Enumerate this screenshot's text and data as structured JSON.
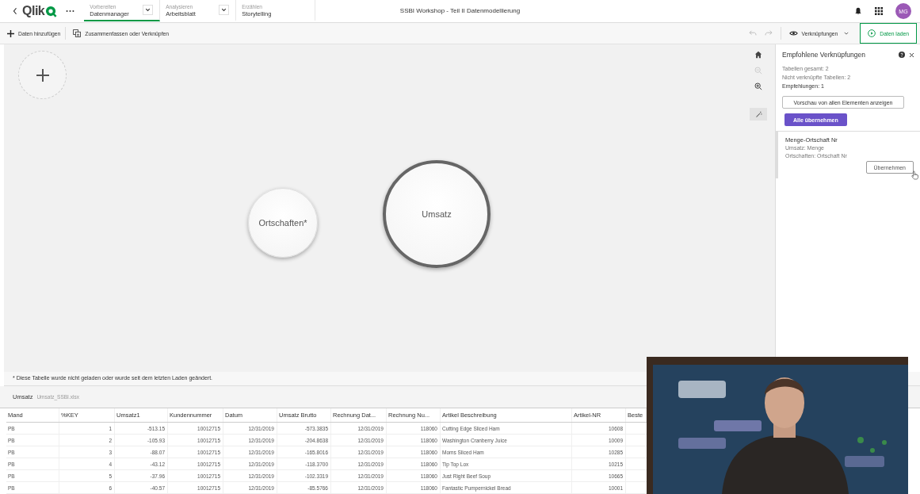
{
  "header": {
    "logo": "Qlik",
    "steps": [
      {
        "caption": "Vorbereiten",
        "label": "Datenmanager",
        "selected": true,
        "dropdown": true
      },
      {
        "caption": "Analysieren",
        "label": "Arbeitsblatt",
        "selected": false,
        "dropdown": true
      },
      {
        "caption": "Erzählen",
        "label": "Storytelling",
        "selected": false,
        "dropdown": false
      }
    ],
    "title": "SSBI Workshop - Teil II Datenmodellierung",
    "avatar": "MG"
  },
  "toolbar": {
    "add": "Daten hinzufügen",
    "merge": "Zusammenfassen oder Verknüpfen",
    "view": "Verknüpfungen",
    "load": "Daten laden"
  },
  "canvas": {
    "tables": [
      {
        "name": "Ortschaften*",
        "selected": false
      },
      {
        "name": "Umsatz",
        "selected": true
      }
    ],
    "note": "* Diese Tabelle wurde nicht geladen oder wurde seit dem letzten Laden geändert."
  },
  "panel": {
    "title": "Empfohlene Verknüpfungen",
    "stats": [
      {
        "text": "Tabellen gesamt: 2",
        "kind": "muted"
      },
      {
        "text": "Nicht verknüpfte Tabellen: 2",
        "kind": "muted"
      },
      {
        "text": "Empfehlungen: 1",
        "kind": "strong"
      }
    ],
    "preview_button": "Vorschau von allen Elementen anzeigen",
    "apply_all_button": "Alle übernehmen",
    "recommendations": [
      {
        "title": "Menge-Ortschaft Nr",
        "lines": [
          "Umsatz: Menge",
          "Ortschaften: Ortschaft Nr"
        ],
        "button": "Übernehmen"
      }
    ]
  },
  "data_table": {
    "name": "Umsatz",
    "source": "Umsatz_SSBI.xlsx",
    "columns": [
      {
        "label": "Mand",
        "kind": "text"
      },
      {
        "label": "%KEY",
        "kind": "number"
      },
      {
        "label": "Umsatz1",
        "kind": "number"
      },
      {
        "label": "Kundennummer",
        "kind": "number"
      },
      {
        "label": "Datum",
        "kind": "number"
      },
      {
        "label": "Umsatz Brutto",
        "kind": "number"
      },
      {
        "label": "Rechnung Dat...",
        "kind": "number"
      },
      {
        "label": "Rechnung Nu...",
        "kind": "number"
      },
      {
        "label": "Artikel Beschreibung",
        "kind": "text"
      },
      {
        "label": "Artikel-NR",
        "kind": "number"
      },
      {
        "label": "Beste",
        "kind": "text"
      }
    ],
    "rows": [
      [
        "PB",
        "1",
        "-513.15",
        "10012715",
        "12/31/2019",
        "-573.3835",
        "12/31/2019",
        "118060",
        "Cutting Edge Sliced Ham",
        "10608"
      ],
      [
        "PB",
        "2",
        "-105.93",
        "10012715",
        "12/31/2019",
        "-204.8638",
        "12/31/2019",
        "118060",
        "Washington Cranberry Juice",
        "10009"
      ],
      [
        "PB",
        "3",
        "-88.07",
        "10012715",
        "12/31/2019",
        "-165.8016",
        "12/31/2019",
        "118060",
        "Moms Sliced Ham",
        "10285"
      ],
      [
        "PB",
        "4",
        "-43.12",
        "10012715",
        "12/31/2019",
        "-118.3700",
        "12/31/2019",
        "118060",
        "Tip Top Lox",
        "10215"
      ],
      [
        "PB",
        "5",
        "-37.96",
        "10012715",
        "12/31/2019",
        "-102.3319",
        "12/31/2019",
        "118060",
        "Just Right Beef Soup",
        "10665"
      ],
      [
        "PB",
        "6",
        "-40.57",
        "10012715",
        "12/31/2019",
        "-85.5766",
        "12/31/2019",
        "118060",
        "Fantastic Pumpernickel Bread",
        "10001"
      ]
    ]
  }
}
